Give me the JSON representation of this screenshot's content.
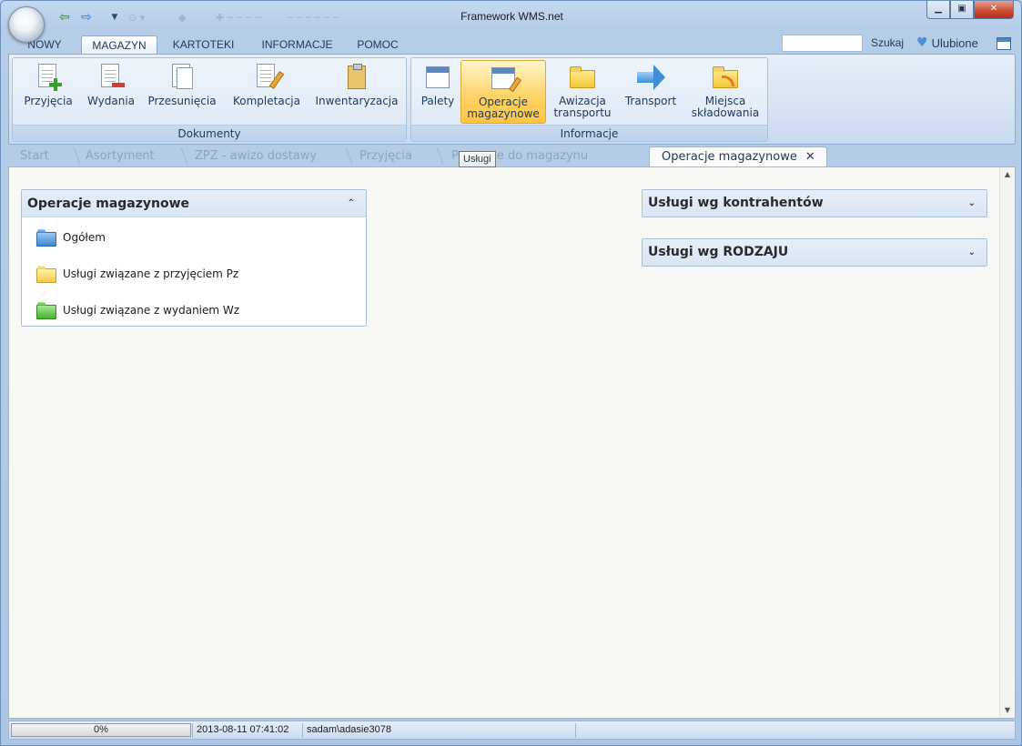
{
  "window": {
    "title": "Framework WMS.net"
  },
  "quick_access": {
    "back_icon": "back-arrow-icon",
    "forward_icon": "forward-arrow-icon",
    "more_icon": "dropdown-icon"
  },
  "ribbon": {
    "tabs": [
      {
        "label": "NOWY",
        "active": false
      },
      {
        "label": "MAGAZYN",
        "active": true
      },
      {
        "label": "KARTOTEKI",
        "active": false
      },
      {
        "label": "INFORMACJE",
        "active": false
      },
      {
        "label": "POMOC",
        "active": false
      }
    ],
    "search_placeholder": "",
    "search_label": "Szukaj",
    "favorites_label": "Ulubione",
    "groups": [
      {
        "label": "Dokumenty",
        "buttons": [
          {
            "label": "Przyjęcia",
            "icon": "document-add-icon"
          },
          {
            "label": "Wydania",
            "icon": "document-remove-icon"
          },
          {
            "label": "Przesunięcia",
            "icon": "documents-copy-icon"
          },
          {
            "label": "Kompletacja",
            "icon": "document-edit-icon"
          },
          {
            "label": "Inwentaryzacja",
            "icon": "clipboard-icon"
          }
        ]
      },
      {
        "label": "Informacje",
        "buttons": [
          {
            "label": "Palety",
            "icon": "pallet-calendar-icon"
          },
          {
            "label_line1": "Operacje",
            "label_line2": "magazynowe",
            "icon": "calendar-edit-icon",
            "selected": true
          },
          {
            "label_line1": "Awizacja",
            "label_line2": "transportu",
            "icon": "folder-icon"
          },
          {
            "label": "Transport",
            "icon": "arrow-right-icon"
          },
          {
            "label_line1": "Miejsca",
            "label_line2": "składowania",
            "icon": "folder-feed-icon"
          }
        ]
      }
    ]
  },
  "doc_tabs": [
    {
      "label": "Start"
    },
    {
      "label": "Asortyment"
    },
    {
      "label": "ZPZ - awizo dostawy"
    },
    {
      "label": "Przyjęcia"
    },
    {
      "label": "Przyjęcie do magazynu"
    },
    {
      "label": "Operacje magazynowe",
      "active": true
    }
  ],
  "tooltip": "Usługi",
  "panels": {
    "left": {
      "title": "Operacje magazynowe",
      "items": [
        {
          "label": "Ogółem",
          "icon": "folder-blue-icon",
          "color": "#3f86d4"
        },
        {
          "label": "Usługi związane z przyjęciem Pz",
          "icon": "folder-yellow-icon",
          "color": "#f3cd49"
        },
        {
          "label": "Usługi związane z wydaniem Wz",
          "icon": "folder-green-icon",
          "color": "#45b42e"
        }
      ]
    },
    "right": [
      {
        "title": "Usługi wg kontrahentów"
      },
      {
        "title": "Usługi wg RODZAJU"
      }
    ]
  },
  "status": {
    "progress_text": "0%",
    "progress_value": 0,
    "datetime": "2013-08-11 07:41:02",
    "user": "sadam\\adasie3078"
  }
}
